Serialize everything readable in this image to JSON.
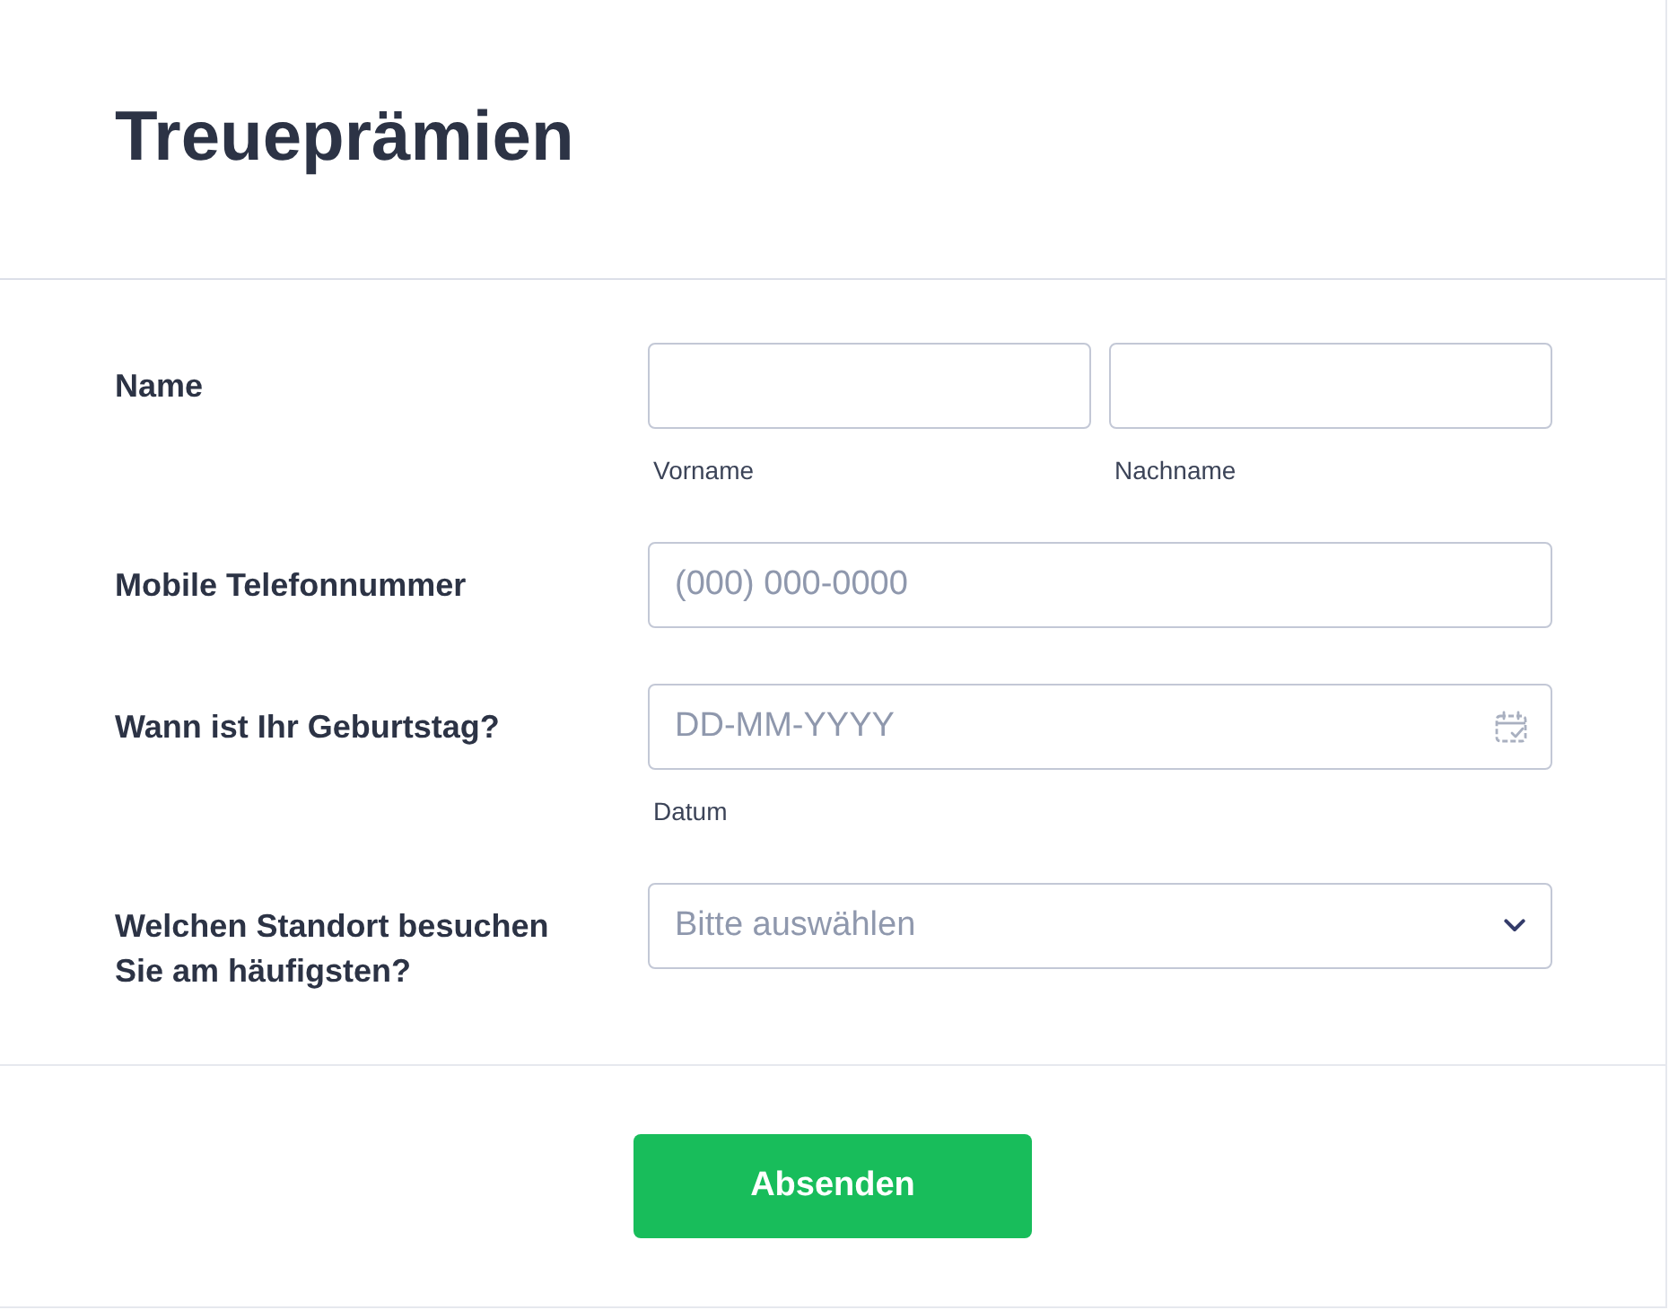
{
  "form": {
    "title": "Treueprämien",
    "fields": [
      {
        "kind": "name",
        "label": "Name",
        "parts": [
          {
            "sublabel": "Vorname"
          },
          {
            "sublabel": "Nachname"
          }
        ]
      },
      {
        "kind": "text",
        "label": "Mobile Telefonnummer",
        "placeholder": "(000) 000-0000"
      },
      {
        "kind": "date",
        "label": "Wann ist Ihr Geburtstag?",
        "placeholder": "DD-MM-YYYY",
        "sublabel": "Datum"
      },
      {
        "kind": "select",
        "label": "Welchen Standort besuchen Sie am häufigsten?",
        "placeholder": "Bitte auswählen"
      }
    ],
    "submit": {
      "label": "Absenden"
    }
  }
}
